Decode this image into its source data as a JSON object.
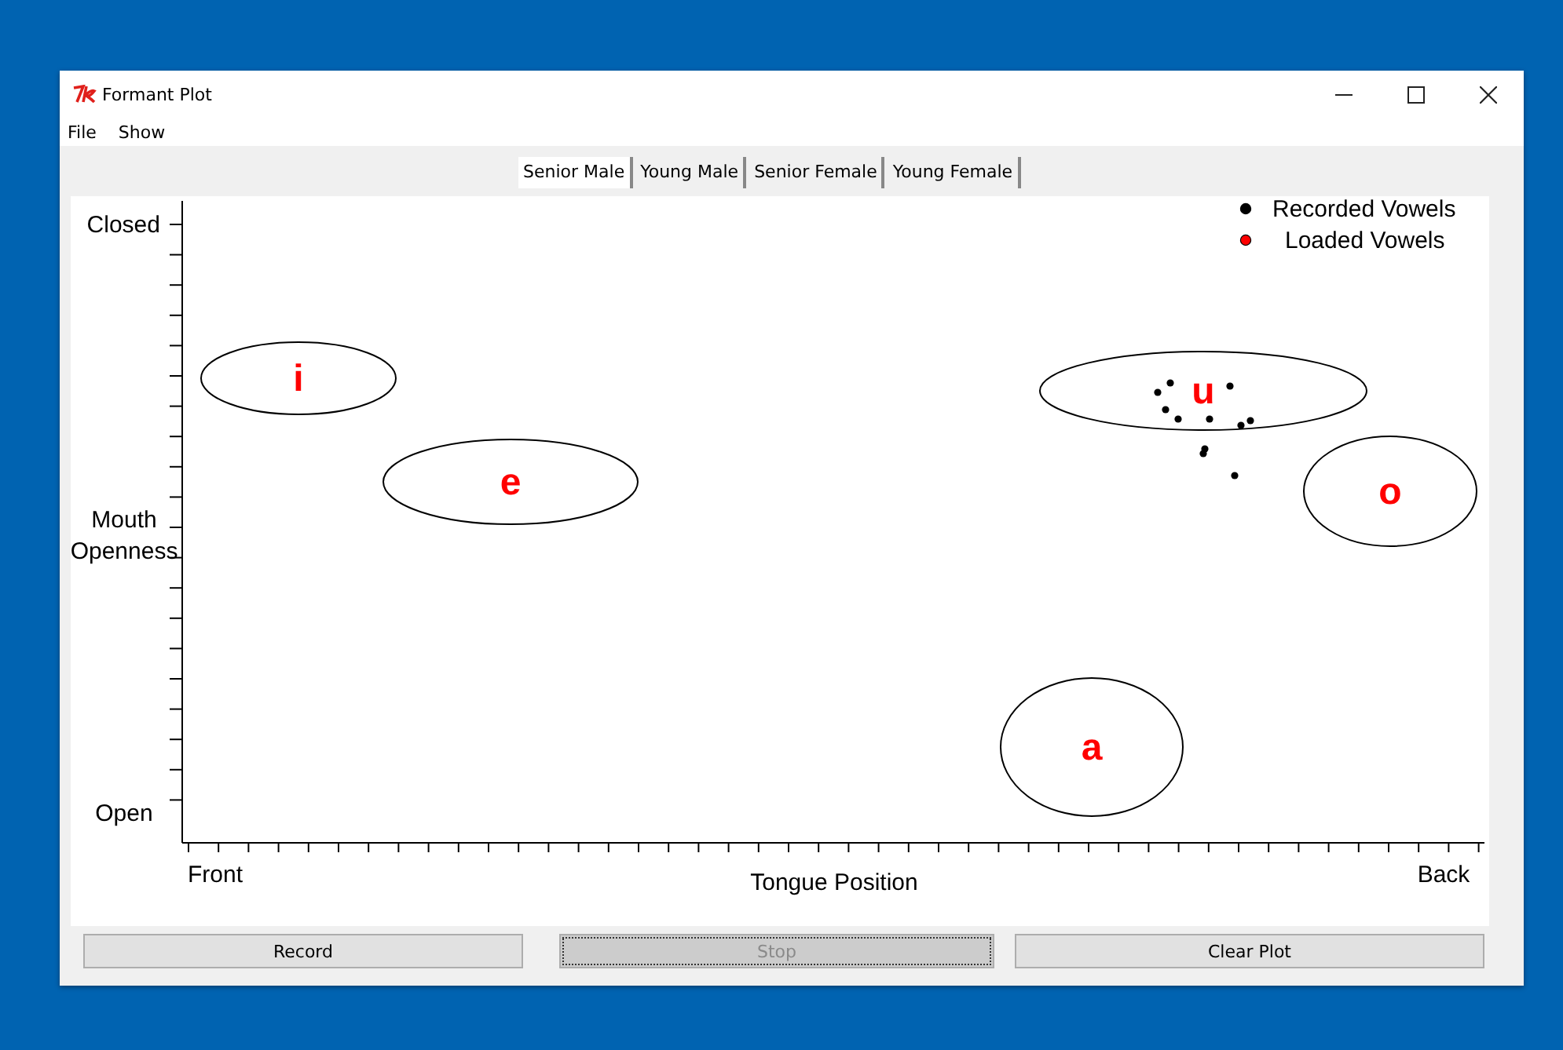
{
  "window": {
    "title": "Formant Plot"
  },
  "menu": [
    "File",
    "Show"
  ],
  "tabs": [
    {
      "label": "Senior Male",
      "selected": true
    },
    {
      "label": "Young Male",
      "selected": false
    },
    {
      "label": "Senior Female",
      "selected": false
    },
    {
      "label": "Young Female",
      "selected": false
    }
  ],
  "plot": {
    "y_labels": [
      "Closed",
      "Mouth\nOpenness",
      "Open"
    ],
    "x_labels": [
      "Front",
      "Back"
    ],
    "x_title": "Tongue Position",
    "legend": [
      {
        "label": "Recorded Vowels",
        "color": "#000000"
      },
      {
        "label": "Loaded Vowels",
        "color": "#ff0000"
      }
    ],
    "vowels": [
      "i",
      "e",
      "u",
      "o",
      "a"
    ]
  },
  "buttons": [
    {
      "label": "Record",
      "disabled": false
    },
    {
      "label": "Stop",
      "disabled": true
    },
    {
      "label": "Clear Plot",
      "disabled": false
    }
  ]
}
